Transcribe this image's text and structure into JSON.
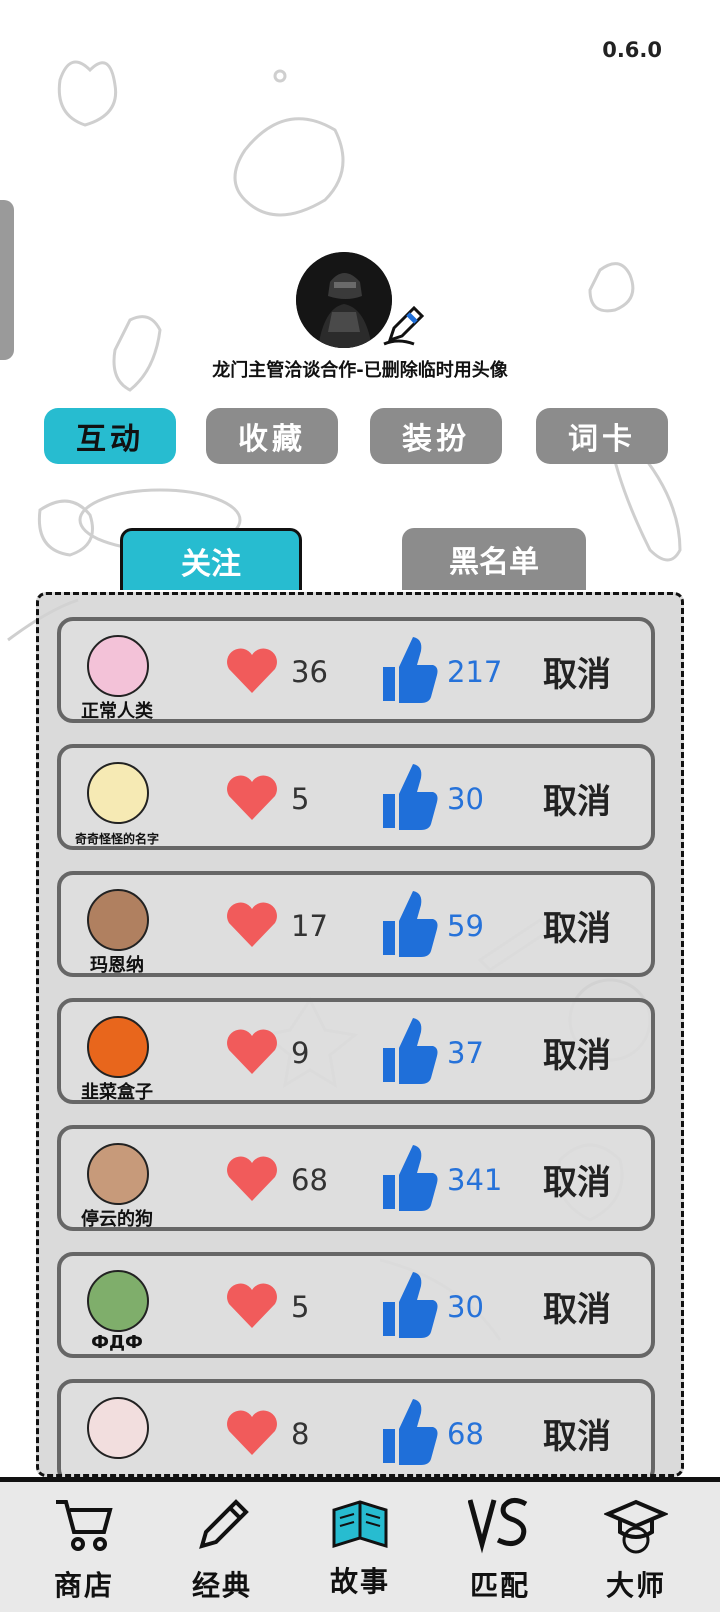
{
  "version": "0.6.0",
  "profile": {
    "username": "龙门主管洽谈合作-已删除临时用头像"
  },
  "category_tabs": [
    {
      "label": "互动",
      "active": true
    },
    {
      "label": "收藏",
      "active": false
    },
    {
      "label": "装扮",
      "active": false
    },
    {
      "label": "词卡",
      "active": false
    }
  ],
  "sub_tabs": {
    "follow": "关注",
    "blacklist": "黑名单"
  },
  "follow_list": [
    {
      "name": "正常人类",
      "hearts": "36",
      "likes": "217",
      "action": "取消",
      "avatar_color": "#f3c2d8"
    },
    {
      "name": "奇奇怪怪的名字",
      "hearts": "5",
      "likes": "30",
      "action": "取消",
      "avatar_color": "#f6eab4"
    },
    {
      "name": "玛恩纳",
      "hearts": "17",
      "likes": "59",
      "action": "取消",
      "avatar_color": "#b08060"
    },
    {
      "name": "韭菜盒子",
      "hearts": "9",
      "likes": "37",
      "action": "取消",
      "avatar_color": "#e8661c"
    },
    {
      "name": "停云的狗",
      "hearts": "68",
      "likes": "341",
      "action": "取消",
      "avatar_color": "#c79a7a"
    },
    {
      "name": "ФДФ",
      "hearts": "5",
      "likes": "30",
      "action": "取消",
      "avatar_color": "#7fae6b"
    },
    {
      "name": "",
      "hearts": "8",
      "likes": "68",
      "action": "取消",
      "avatar_color": "#f2dede"
    }
  ],
  "bottom_nav": [
    {
      "label": "商店",
      "icon": "cart-icon"
    },
    {
      "label": "经典",
      "icon": "pencil-icon"
    },
    {
      "label": "故事",
      "icon": "book-icon"
    },
    {
      "label": "匹配",
      "icon": "vs-icon"
    },
    {
      "label": "大师",
      "icon": "graduation-cap-icon"
    }
  ],
  "colors": {
    "accent": "#27bcd0",
    "inactive_tab": "#8c8c8c",
    "heart": "#f15b5b",
    "like": "#1f6fd9"
  }
}
